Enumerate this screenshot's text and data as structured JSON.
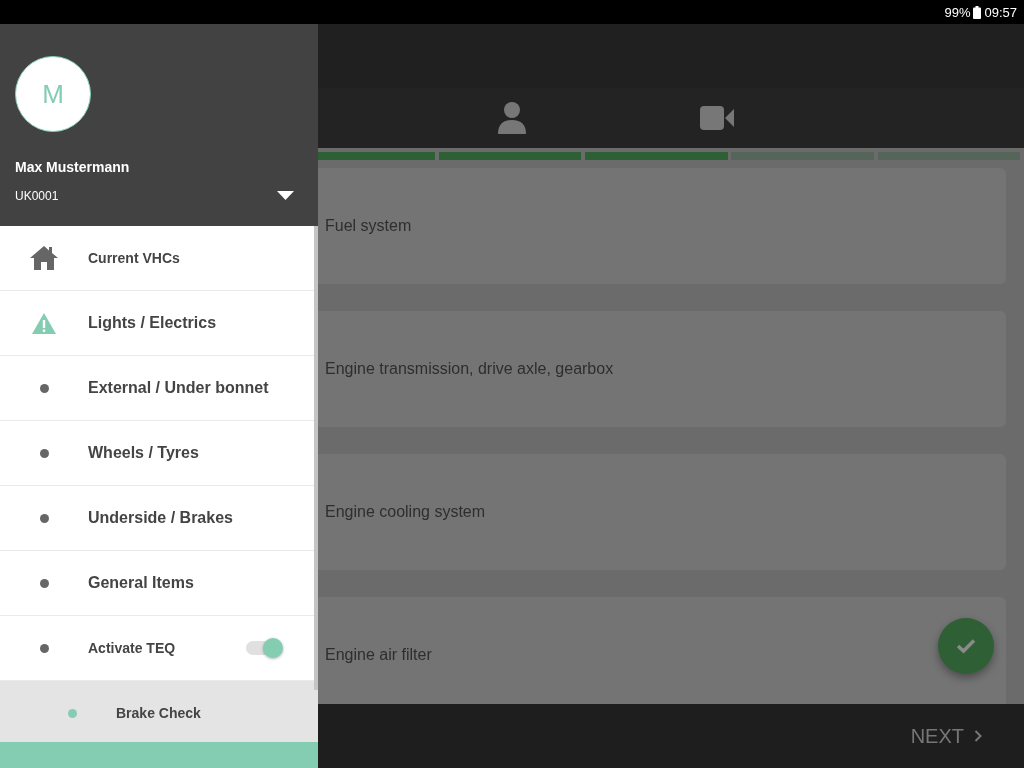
{
  "status_bar": {
    "battery": "99%",
    "time": "09:57"
  },
  "progress": {
    "level": 0.714
  },
  "checklist": [
    {
      "label": "Fuel system"
    },
    {
      "label": "Engine transmission, drive axle, gearbox"
    },
    {
      "label": "Engine cooling system"
    },
    {
      "label": "Engine air filter"
    }
  ],
  "bottom_bar": {
    "next": "NEXT"
  },
  "drawer": {
    "avatar": "M",
    "name": "Max Mustermann",
    "account": "UK0001",
    "items": [
      {
        "kind": "home",
        "label": "Current VHCs",
        "selected": false
      },
      {
        "kind": "warning",
        "label": "Lights / Electrics",
        "selected": false
      },
      {
        "kind": "bullet",
        "label": "External / Under bonnet",
        "selected": false
      },
      {
        "kind": "bullet",
        "label": "Wheels / Tyres",
        "selected": false
      },
      {
        "kind": "bullet",
        "label": "Underside / Brakes",
        "selected": false
      },
      {
        "kind": "bullet",
        "label": "General Items",
        "selected": false
      },
      {
        "kind": "toggle",
        "label": "Activate TEQ",
        "selected": false,
        "on": true,
        "children": [
          {
            "kind": "bullet",
            "label": "Brake Check",
            "selected": true
          }
        ]
      }
    ]
  }
}
